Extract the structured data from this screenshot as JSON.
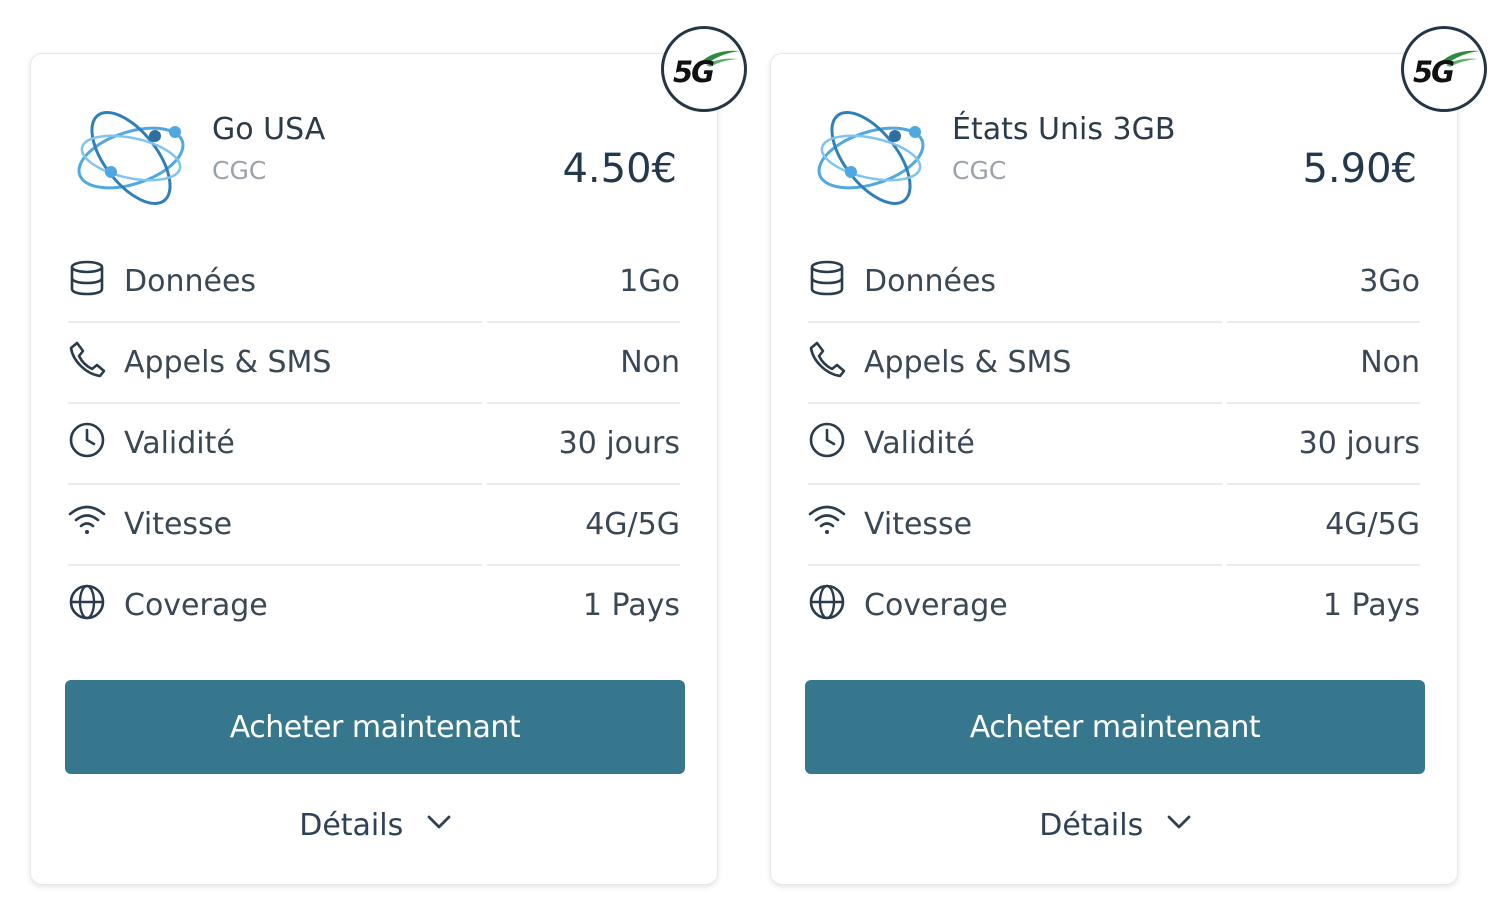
{
  "badge": {
    "label": "5G"
  },
  "cards": [
    {
      "name": "Go USA",
      "carrier": "CGC",
      "price": "4.50€",
      "rows": [
        {
          "icon": "database-icon",
          "label": "Données",
          "value": "1Go"
        },
        {
          "icon": "phone-icon",
          "label": "Appels & SMS",
          "value": "Non"
        },
        {
          "icon": "clock-icon",
          "label": "Validité",
          "value": "30 jours"
        },
        {
          "icon": "wifi-icon",
          "label": "Vitesse",
          "value": "4G/5G"
        },
        {
          "icon": "globe-icon",
          "label": "Coverage",
          "value": "1 Pays"
        }
      ],
      "buy_label": "Acheter maintenant",
      "details_label": "Détails"
    },
    {
      "name": "États Unis 3GB",
      "carrier": "CGC",
      "price": "5.90€",
      "rows": [
        {
          "icon": "database-icon",
          "label": "Données",
          "value": "3Go"
        },
        {
          "icon": "phone-icon",
          "label": "Appels & SMS",
          "value": "Non"
        },
        {
          "icon": "clock-icon",
          "label": "Validité",
          "value": "30 jours"
        },
        {
          "icon": "wifi-icon",
          "label": "Vitesse",
          "value": "4G/5G"
        },
        {
          "icon": "globe-icon",
          "label": "Coverage",
          "value": "1 Pays"
        }
      ],
      "buy_label": "Acheter maintenant",
      "details_label": "Détails"
    }
  ],
  "colors": {
    "button": "#37778d",
    "price": "#24384c",
    "text": "#3a4754",
    "muted": "#9aa2aa",
    "badge_green": "#2e8b3e"
  }
}
